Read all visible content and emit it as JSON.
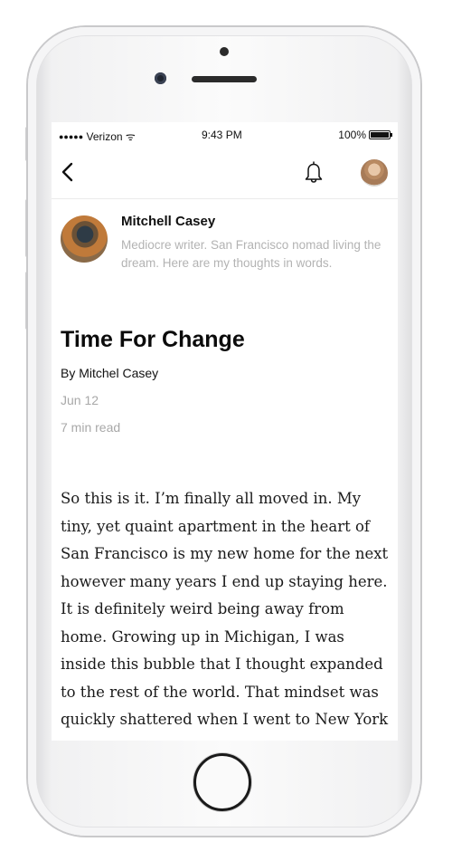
{
  "status_bar": {
    "signal_dots": "●●●●●",
    "carrier": "Verizon",
    "wifi_glyph": "ᯤ",
    "time": "9:43 PM",
    "battery_percent": "100%"
  },
  "navbar": {
    "back_icon": "chevron-left",
    "notifications_icon": "bell",
    "profile_avatar": "avatar"
  },
  "author": {
    "name": "Mitchell Casey",
    "bio": "Mediocre writer. San Francisco nomad living the dream. Here are my thoughts in words."
  },
  "article": {
    "title": "Time For Change",
    "byline": "By Mitchel Casey",
    "date": "Jun 12",
    "read_time": "7 min read",
    "body": "So this is it. I’m finally all moved in. My tiny, yet quaint apartment in the heart of San Francisco is my new home for the next however many years I end up staying here. It is definitely weird being away from home. Growing up in Michigan, I was inside this bubble that I thought expanded to the rest of the world. That mindset was quickly shattered when I went to New York City for"
  }
}
